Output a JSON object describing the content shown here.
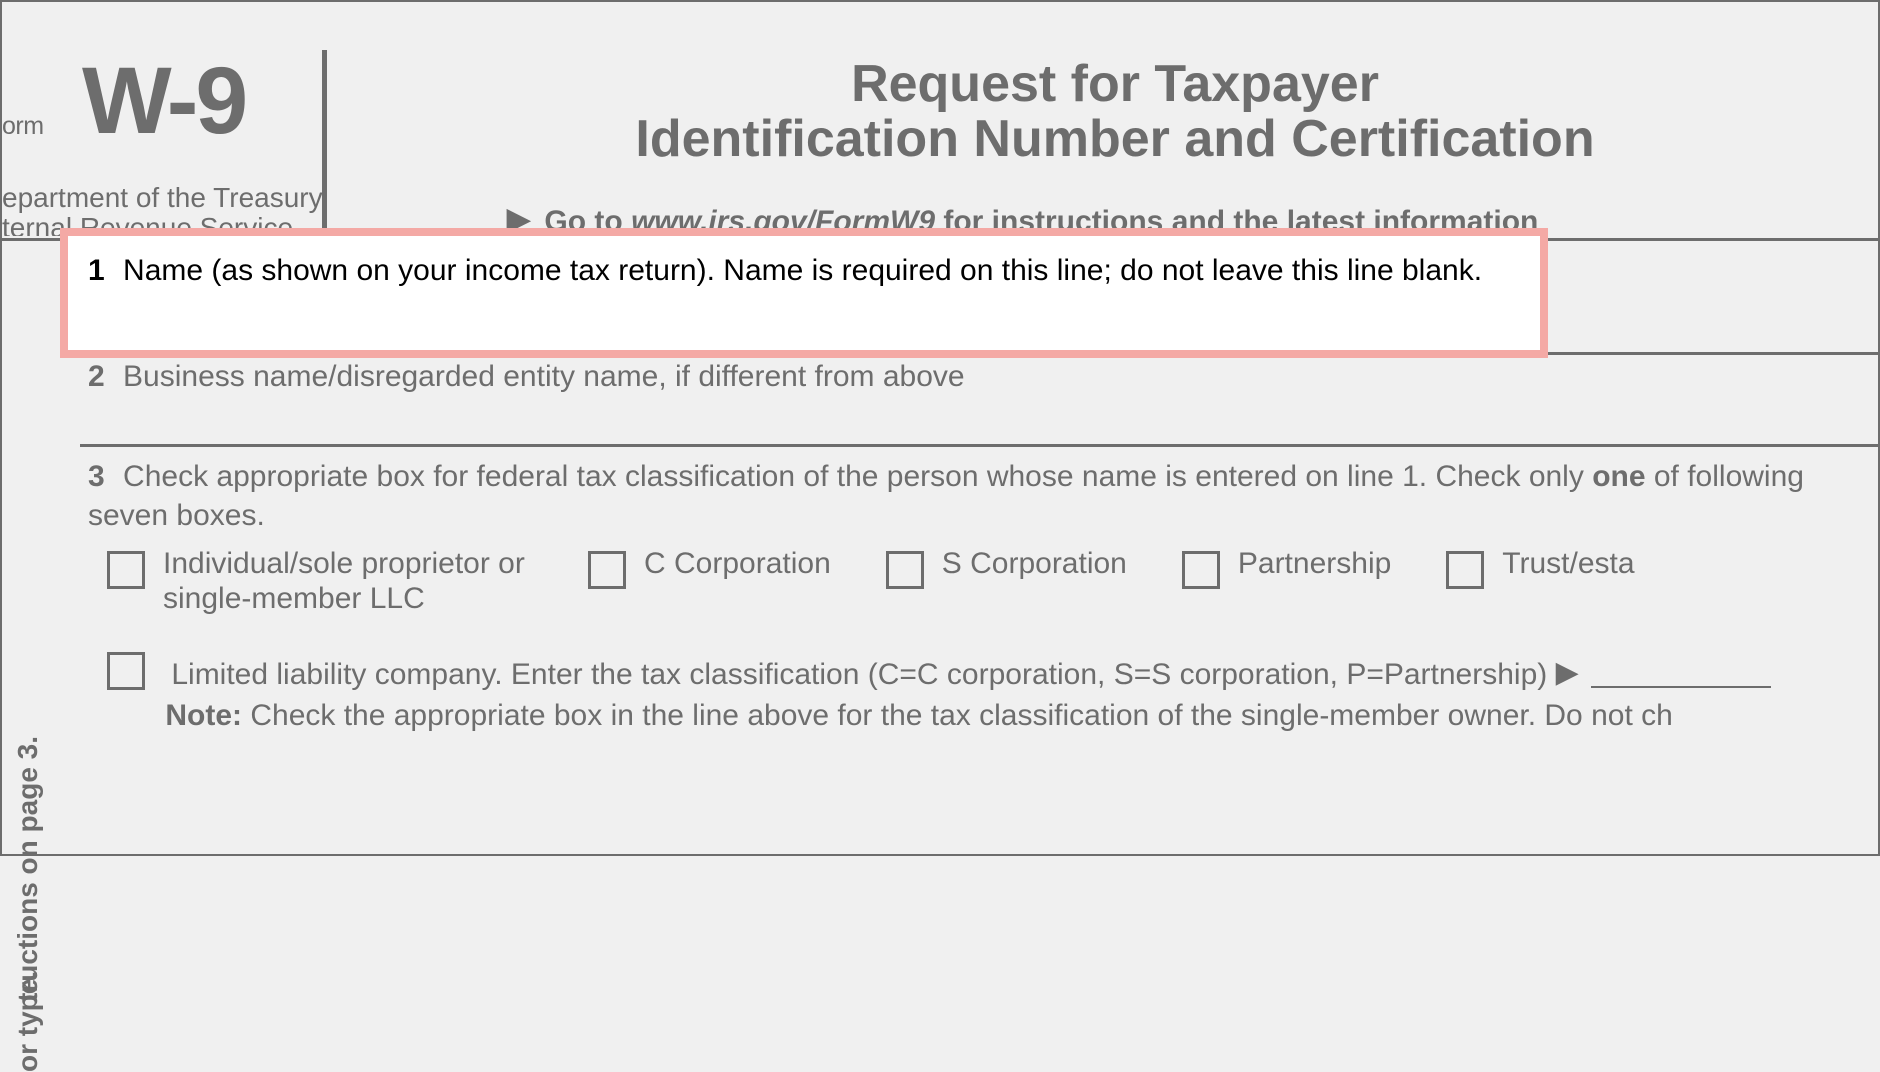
{
  "header": {
    "form_word": "orm",
    "form_code": "W-9",
    "dept": "epartment of the Treasury",
    "irs": "ternal Revenue Service",
    "title_line1": "Request for Taxpayer",
    "title_line2": "Identification Number and Certification",
    "goto_prefix": "Go to ",
    "goto_url": "www.irs.gov/FormW9",
    "goto_suffix": " for instructions and the latest information"
  },
  "rows": {
    "r1_num": "1",
    "r1_text": "Name (as shown on your income tax return). Name is required on this line; do not leave this line blank.",
    "r2_num": "2",
    "r2_text": "Business name/disregarded entity name, if different from above",
    "r3_num": "3",
    "r3_text_a": "Check appropriate box for federal tax classification of the person whose name is entered on line 1. Check only ",
    "r3_text_one": "one",
    "r3_text_b": " of following seven boxes."
  },
  "checkboxes": {
    "c1": "Individual/sole proprietor or single-member LLC",
    "c2": "C Corporation",
    "c3": "S Corporation",
    "c4": "Partnership",
    "c5": "Trust/esta"
  },
  "llc": {
    "text": "Limited liability company. Enter the tax classification (C=C corporation, S=S corporation, P=Partnership)",
    "note_label": "Note:",
    "note_text": " Check the appropriate box in the line above for the tax classification of the single-member owner.  Do not ch"
  },
  "sidebar": {
    "a": "tructions on page 3.",
    "b": "or type."
  }
}
